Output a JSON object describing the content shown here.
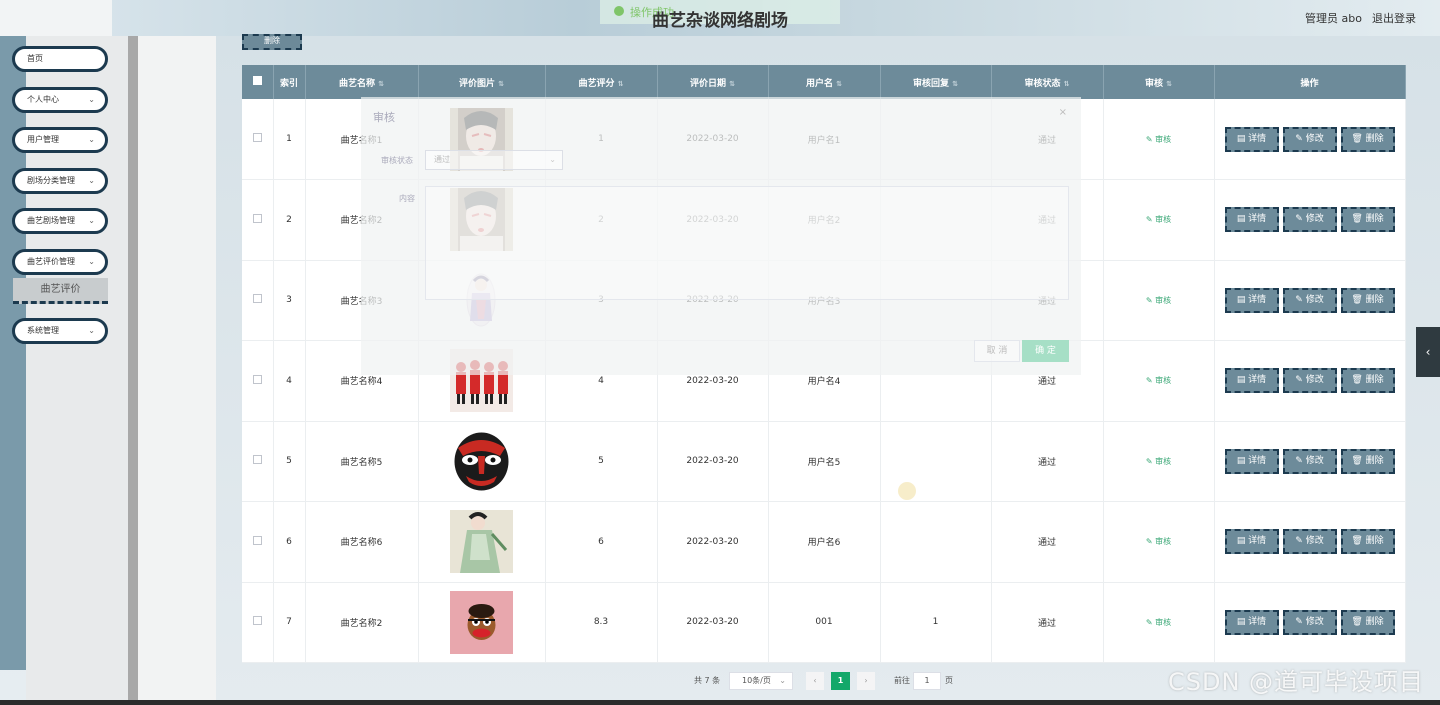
{
  "header": {
    "title": "曲艺杂谈网络剧场",
    "user_label": "管理员 abo",
    "logout_label": "退出登录",
    "toast_text": "操作成功"
  },
  "sidebar": {
    "items": [
      {
        "label": "首页",
        "has_chevron": false
      },
      {
        "label": "个人中心",
        "has_chevron": true
      },
      {
        "label": "用户管理",
        "has_chevron": true
      },
      {
        "label": "剧场分类管理",
        "has_chevron": true
      },
      {
        "label": "曲艺剧场管理",
        "has_chevron": true
      },
      {
        "label": "曲艺评价管理",
        "has_chevron": true
      },
      {
        "label": "系统管理",
        "has_chevron": true
      }
    ],
    "active_sub": "曲艺评价",
    "chevron": "⌄"
  },
  "toolbar": {
    "delete_label": "删除"
  },
  "table": {
    "headers": [
      "索引",
      "曲艺名称",
      "评价图片",
      "曲艺评分",
      "评价日期",
      "用户名",
      "审核回复",
      "审核状态",
      "审核",
      "操作"
    ],
    "sort_glyph": "⇅",
    "audit_label": "✎ 审核",
    "btn_detail": "▤ 详情",
    "btn_edit": "✎ 修改",
    "btn_delete": "🗑 删除",
    "rows": [
      {
        "idx": "1",
        "name": "曲艺名称1",
        "score": "1",
        "date": "2022-03-20",
        "user": "用户名1",
        "reply": "",
        "status": "通过",
        "img": "opera-face-1"
      },
      {
        "idx": "2",
        "name": "曲艺名称2",
        "score": "2",
        "date": "2022-03-20",
        "user": "用户名2",
        "reply": "",
        "status": "通过",
        "img": "opera-face-1"
      },
      {
        "idx": "3",
        "name": "曲艺名称3",
        "score": "3",
        "date": "2022-03-20",
        "user": "用户名3",
        "reply": "",
        "status": "通过",
        "img": "opera-figure"
      },
      {
        "idx": "4",
        "name": "曲艺名称4",
        "score": "4",
        "date": "2022-03-20",
        "user": "用户名4",
        "reply": "",
        "status": "通过",
        "img": "red-figures"
      },
      {
        "idx": "5",
        "name": "曲艺名称5",
        "score": "5",
        "date": "2022-03-20",
        "user": "用户名5",
        "reply": "",
        "status": "通过",
        "img": "opera-mask"
      },
      {
        "idx": "6",
        "name": "曲艺名称6",
        "score": "6",
        "date": "2022-03-20",
        "user": "用户名6",
        "reply": "",
        "status": "通过",
        "img": "opera-green"
      },
      {
        "idx": "7",
        "name": "曲艺名称2",
        "score": "8.3",
        "date": "2022-03-20",
        "user": "001",
        "reply": "1",
        "status": "通过",
        "img": "pink-cartoon"
      }
    ]
  },
  "dialog": {
    "title": "审核",
    "close": "×",
    "status_label": "审核状态",
    "status_value": "通过",
    "content_label": "内容",
    "cancel": "取 消",
    "confirm": "确 定"
  },
  "pagination": {
    "total": "共 7 条",
    "page_size": "10条/页",
    "current": "1",
    "goto_label": "前往",
    "goto_value": "1",
    "page_suffix": "页",
    "prev": "‹",
    "next": "›"
  },
  "right_tab_icon": "‹",
  "watermark": "CSDN @道可毕设项目"
}
